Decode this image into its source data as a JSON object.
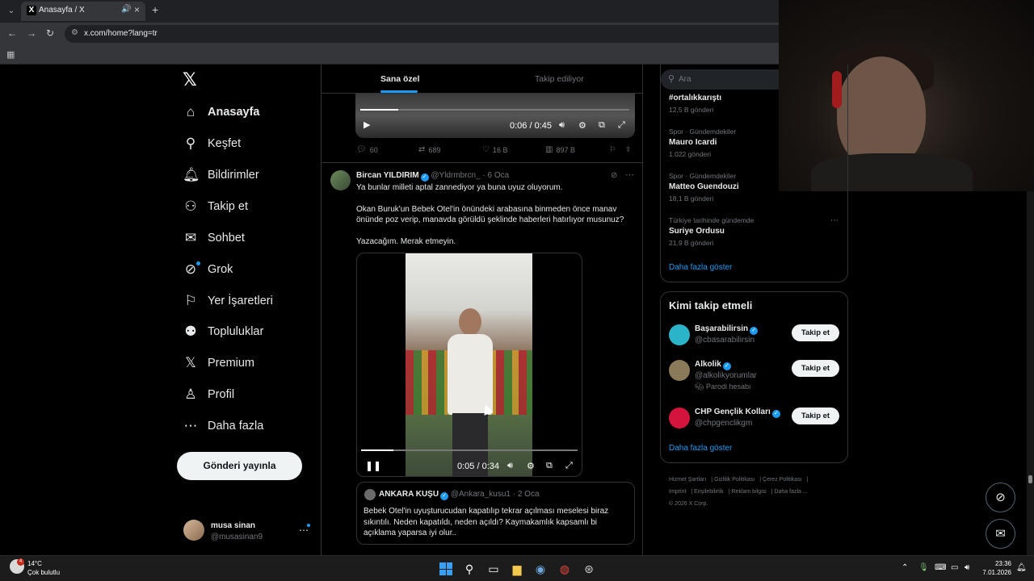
{
  "browser": {
    "tab_title": "Anasayfa / X",
    "url": "x.com/home?lang=tr"
  },
  "sidebar": {
    "items": [
      {
        "label": "Anasayfa",
        "icon": "home-icon"
      },
      {
        "label": "Keşfet",
        "icon": "search-icon"
      },
      {
        "label": "Bildirimler",
        "icon": "bell-icon"
      },
      {
        "label": "Takip et",
        "icon": "person-add-icon"
      },
      {
        "label": "Sohbet",
        "icon": "mail-icon"
      },
      {
        "label": "Grok",
        "icon": "grok-icon"
      },
      {
        "label": "Yer İşaretleri",
        "icon": "bookmark-icon"
      },
      {
        "label": "Topluluklar",
        "icon": "people-icon"
      },
      {
        "label": "Premium",
        "icon": "x-icon"
      },
      {
        "label": "Profil",
        "icon": "profile-icon"
      },
      {
        "label": "Daha fazla",
        "icon": "more-icon"
      }
    ],
    "post_button": "Gönderi yayınla",
    "account": {
      "name": "musa sinan",
      "handle": "@musasinan9"
    }
  },
  "feed": {
    "tabs": [
      "Sana özel",
      "Takip ediliyor"
    ],
    "post1": {
      "video_time": "0:06 / 0:45",
      "video_progress": 0.14,
      "replies": "60",
      "reposts": "689",
      "likes": "16 B",
      "views": "897 B"
    },
    "post2": {
      "name": "Bircan YILDIRIM",
      "handle": "@Yldrmbrcn_",
      "date": "· 6 Oca",
      "text": [
        "Ya bunlar milleti aptal zannediyor ya buna uyuz oluyorum.",
        "Okan Buruk'un Bebek Otel'in önündeki arabasına binmeden önce  manav önünde poz verip, manavda görüldü şeklinde haberleri hatırlıyor musunuz?",
        "Yazacağım. Merak etmeyin."
      ],
      "video_time": "0:05 / 0:34",
      "video_progress": 0.15,
      "quote": {
        "name": "ANKARA KUŞU",
        "handle": "@Ankara_kusu1",
        "date": "· 2 Oca",
        "text": "Bebek Otel'in uyuşturucudan kapatılıp tekrar açılması meselesi biraz sıkıntılı. Neden kapatıldı, neden açıldı? Kaymakamlık kapsamlı bi açıklama yaparsa iyi olur.."
      }
    }
  },
  "right": {
    "search_placeholder": "Ara",
    "trends": [
      {
        "category": "",
        "name": "#ortalıkkarıştı",
        "count": "12,5 B gönderi"
      },
      {
        "category": "Spor · Gündemdekiler",
        "name": "Mauro Icardi",
        "count": "1.022 gönderi"
      },
      {
        "category": "Spor · Gündemdekiler",
        "name": "Matteo Guendouzi",
        "count": "18,1 B gönderi"
      },
      {
        "category": "Türkiye tarihinde gündemde",
        "name": "Suriye Ordusu",
        "count": "21,9 B gönderi"
      }
    ],
    "show_more": "Daha fazla göster",
    "who_to_follow": {
      "title": "Kimi takip etmeli",
      "accounts": [
        {
          "name": "Başarabilirsin",
          "handle": "@cbasarabilirsin",
          "extra": "",
          "color": "#2bb3c9"
        },
        {
          "name": "Alkolik",
          "handle": "@alkolikyorumlar",
          "extra": "Parodi hesabı",
          "color": "#8a7a5a"
        },
        {
          "name": "CHP Gençlik Kolları",
          "handle": "@chpgenclikgm",
          "extra": "",
          "color": "#d4143c"
        }
      ],
      "follow_label": "Takip et",
      "show_more": "Daha fazla göster"
    },
    "footer": [
      "Hizmet Şartları",
      "Gizlilik Politikası",
      "Çerez Politikası",
      "Imprint",
      "Erişilebilirlik",
      "Reklam bilgisi",
      "Daha fazla ...",
      "© 2026 X Corp."
    ]
  },
  "taskbar": {
    "temp": "14°C",
    "weather": "Çok bulutlu",
    "weather_badge": "4",
    "time": "23:36",
    "date": "7.01.2026"
  }
}
